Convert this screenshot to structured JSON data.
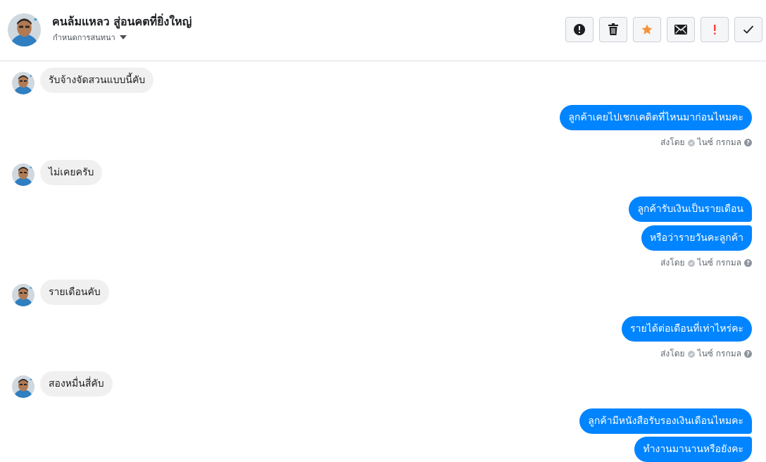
{
  "header": {
    "name": "คนล้มแหลว สู่อนคตที่ยิ่งใหญ่",
    "subtitle": "กำหนดการสนทนา"
  },
  "toolbar": [
    {
      "name": "alert-button",
      "icon": "exclamation-circle-icon"
    },
    {
      "name": "delete-button",
      "icon": "trash-icon"
    },
    {
      "name": "star-button",
      "icon": "star-icon"
    },
    {
      "name": "mark-unread-button",
      "icon": "envelope-icon"
    },
    {
      "name": "important-button",
      "icon": "exclamation-icon"
    },
    {
      "name": "done-button",
      "icon": "checkmark-icon"
    }
  ],
  "colors": {
    "outgoing_bubble": "#0084ff",
    "incoming_bubble": "#f1f0f0",
    "star": "#f7923a",
    "important": "#fa3e3e"
  },
  "messages": [
    {
      "dir": "in",
      "text": "รับจ้างจัดสวนแบบนี้คับ"
    },
    {
      "dir": "out",
      "text": "ลูกค้าเคยไปเชกเคดิตที่ไหนมาก่อนไหมคะ"
    },
    {
      "dir": "in",
      "text": "ไม่เคยครับ"
    },
    {
      "dir": "out",
      "text": "ลูกค้ารับเงินเป็นรายเดือน"
    },
    {
      "dir": "out",
      "text": "หรือว่ารายวันคะลูกค้า"
    },
    {
      "dir": "in",
      "text": "รายเดือนคับ"
    },
    {
      "dir": "out",
      "text": "รายได้ต่อเดือนที่เท่าไหร่คะ"
    },
    {
      "dir": "in",
      "text": "สองหมื่นสี่คับ"
    },
    {
      "dir": "out",
      "text": "ลูกค้ามีหนังสือรับรองเงินเดือนไหมคะ"
    },
    {
      "dir": "out",
      "text": "ทำงานมานานหรือยังคะ"
    }
  ],
  "sent_by": {
    "prefix": "ส่งโดย",
    "agent": "ไนซ์ กรกมล"
  }
}
